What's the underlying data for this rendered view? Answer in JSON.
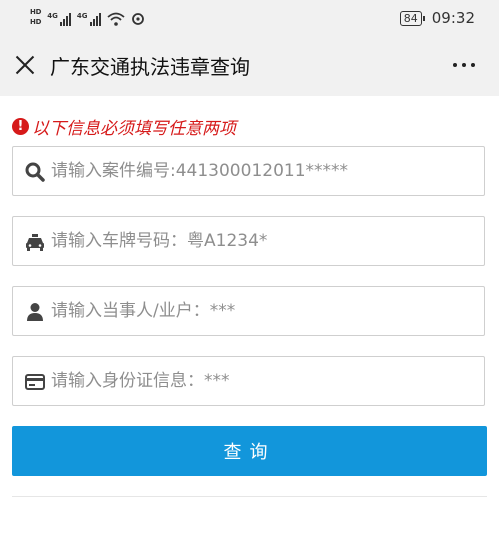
{
  "status_bar": {
    "hd1": "HD",
    "hd2": "HD",
    "net1": "4G",
    "net2": "4G",
    "battery": "84",
    "time": "09:32"
  },
  "header": {
    "title": "广东交通执法违章查询"
  },
  "notice": {
    "icon": "!",
    "text": "以下信息必须填写任意两项"
  },
  "form": {
    "fields": [
      {
        "icon": "search-icon",
        "placeholder": "请输入案件编号:441300012011*****"
      },
      {
        "icon": "car-icon",
        "placeholder": "请输入车牌号码：粤A1234*"
      },
      {
        "icon": "user-icon",
        "placeholder": "请输入当事人/业户：***"
      },
      {
        "icon": "id-card-icon",
        "placeholder": "请输入身份证信息：***"
      }
    ],
    "submit_label": "查询"
  },
  "colors": {
    "accent": "#1296db",
    "warning": "#d61a1a",
    "header_bg": "#f1f1f1"
  }
}
